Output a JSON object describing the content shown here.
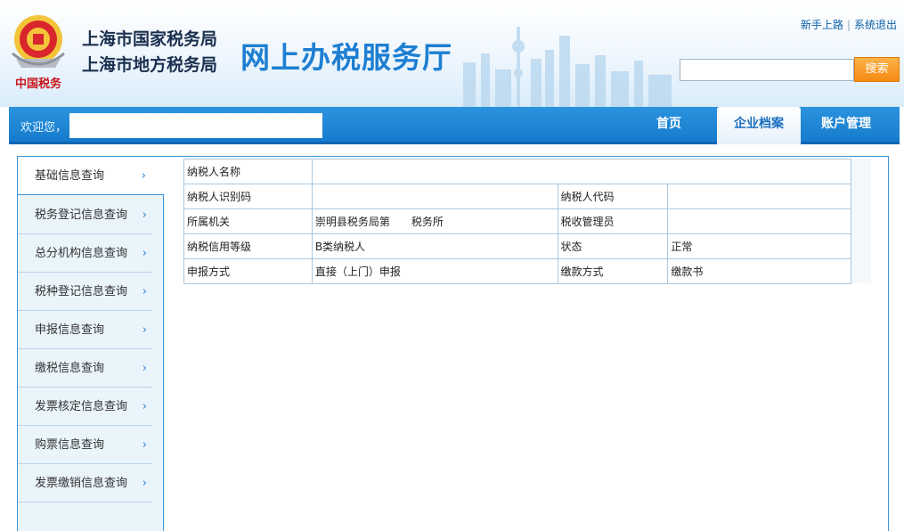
{
  "header": {
    "bureau_line1": "上海市国家税务局",
    "bureau_line2": "上海市地方税务局",
    "hall_title": "网上办税服务厅",
    "emblem_text": "中国税务",
    "links": {
      "guide": "新手上路",
      "separator": "|",
      "logout": "系统退出"
    },
    "search": {
      "placeholder": "",
      "button_label": "搜索"
    }
  },
  "nav": {
    "welcome": "欢迎您，",
    "tabs": [
      {
        "label": "首页"
      },
      {
        "label": "企业档案"
      },
      {
        "label": "账户管理"
      }
    ],
    "active_tab": "企业档案"
  },
  "sidebar": {
    "items": [
      {
        "label": "基础信息查询"
      },
      {
        "label": "税务登记信息查询"
      },
      {
        "label": "总分机构信息查询"
      },
      {
        "label": "税种登记信息查询"
      },
      {
        "label": "申报信息查询"
      },
      {
        "label": "缴税信息查询"
      },
      {
        "label": "发票核定信息查询"
      },
      {
        "label": "购票信息查询"
      },
      {
        "label": "发票缴销信息查询"
      }
    ],
    "active_item": "基础信息查询",
    "chevron": "›"
  },
  "info": {
    "rows": [
      {
        "label1": "纳税人名称",
        "value1": "",
        "label2": "",
        "value2": ""
      },
      {
        "label1": "纳税人识别码",
        "value1": "",
        "label2": "纳税人代码",
        "value2": ""
      },
      {
        "label1": "所属机关",
        "value1": "崇明县税务局第　　税务所",
        "label2": "税收管理员",
        "value2": ""
      },
      {
        "label1": "纳税信用等级",
        "value1": "B类纳税人",
        "label2": "状态",
        "value2": "正常"
      },
      {
        "label1": "申报方式",
        "value1": "直接（上门）申报",
        "label2": "缴款方式",
        "value2": "缴款书"
      }
    ]
  },
  "colors": {
    "nav_blue": "#1a84d4",
    "frame_border": "#3f94d6",
    "search_orange": "#f58a12",
    "title_blue": "#1e7fd2"
  }
}
